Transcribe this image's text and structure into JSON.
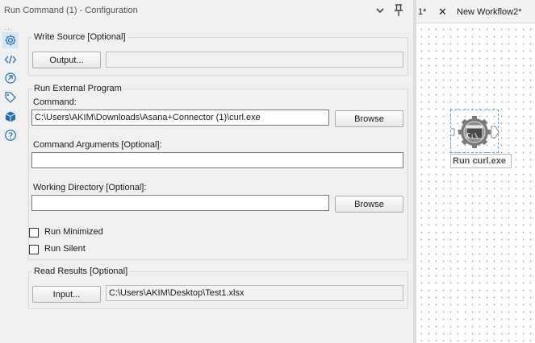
{
  "window": {
    "title": "Run Command (1) - Configuration"
  },
  "sidebar": {
    "more_dots": "...",
    "icons": [
      "gear-icon",
      "code-icon",
      "rotate-icon",
      "tag-icon",
      "package-icon",
      "help-icon"
    ]
  },
  "write_source": {
    "group_label": "Write Source [Optional]",
    "output_button": "Output...",
    "output_value": ""
  },
  "run_external": {
    "group_label": "Run External Program",
    "command_label": "Command:",
    "command_value": "C:\\Users\\AKIM\\Downloads\\Asana+Connector (1)\\curl.exe",
    "browse_label": "Browse",
    "args_label": "Command Arguments [Optional]:",
    "args_value": "",
    "workdir_label": "Working Directory [Optional]:",
    "workdir_value": "",
    "browse2_label": "Browse",
    "run_minimized_label": "Run Minimized",
    "run_minimized_checked": false,
    "run_silent_label": "Run Silent",
    "run_silent_checked": false
  },
  "read_results": {
    "group_label": "Read Results [Optional]",
    "input_button": "Input...",
    "input_value": "C:\\Users\\AKIM\\Desktop\\Test1.xlsx"
  },
  "tabs": {
    "tab1_label": "1*",
    "close_symbol": "✕",
    "tab2_label": "New Workflow2*"
  },
  "canvas": {
    "tool_label": "Run curl.exe",
    "tool_icon_text": "C:\\"
  },
  "colors": {
    "accent": "#1f6fb5",
    "selection_border": "#6aa0d8",
    "tool_gear": "#7a7a7a"
  }
}
